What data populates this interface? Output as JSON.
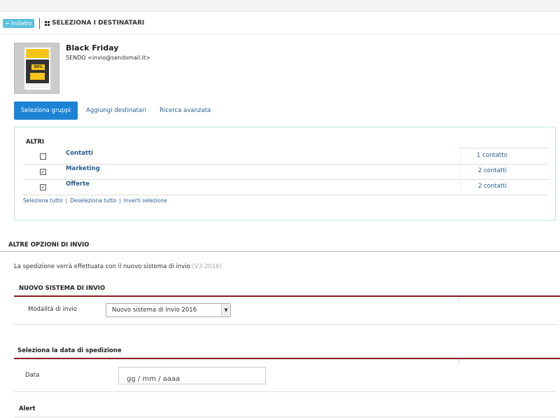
{
  "header": {
    "back_label": "Indietro",
    "back_icon": "arrow-left-icon",
    "title": "SELEZIONA I DESTINATARI",
    "title_icon": "grid-icon"
  },
  "campaign": {
    "name": "Black Friday",
    "sender": "SENDO <invio@sendomail.it>",
    "thumbnail_badge": "50%"
  },
  "tabs": [
    {
      "label": "Seleziona gruppi",
      "active": true
    },
    {
      "label": "Aggiungi destinatari",
      "active": false
    },
    {
      "label": "Ricerca avanzata",
      "active": false
    }
  ],
  "groups": {
    "section_title": "ALTRI",
    "rows": [
      {
        "name": "Contatti",
        "count": "1 contatto",
        "checked": false
      },
      {
        "name": "Marketing",
        "count": "2 contatti",
        "checked": true
      },
      {
        "name": "Offerte",
        "count": "2 contatti",
        "checked": true
      }
    ],
    "select_all": "Seleziona tutto",
    "deselect_all": "Deseleziona tutto",
    "invert": "Inverti selezione"
  },
  "other_options": {
    "title": "ALTRE OPZIONI DI INVIO",
    "info_text": "La spedizione verrà effettuata con il nuovo sistema di invio",
    "info_version": "(V3-2016)",
    "new_system": {
      "title": "NUOVO SISTEMA DI INVIO",
      "mode_label": "Modalità di invio",
      "mode_value": "Nuovo sistema di invio 2016"
    },
    "date": {
      "title": "Seleziona la data di spedizione",
      "label": "Data",
      "placeholder": "gg / mm / aaaa"
    },
    "alert_title": "Alert"
  },
  "colors": {
    "accent": "#1d83d4",
    "back_button": "#5bc0de",
    "link": "#2a5d8f",
    "section_rule": "#8b1a1a"
  }
}
